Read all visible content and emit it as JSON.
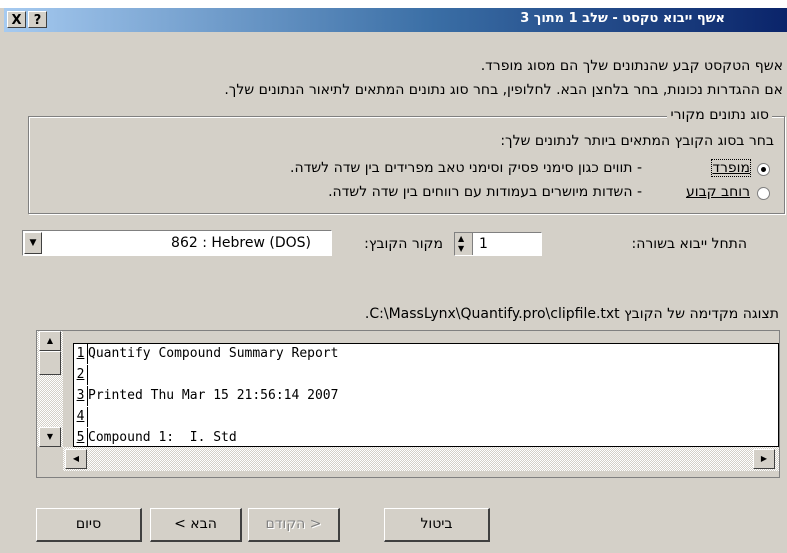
{
  "window": {
    "title": "אשף ייבוא טקסט - שלב 1 מתוך 3",
    "help_label": "?",
    "close_label": "X"
  },
  "intro": {
    "line1": "אשף הטקסט קבע שהנתונים שלך הם מסוג מופרד.",
    "line2": "אם ההגדרות נכונות, בחר בלחצן הבא. לחלופין, בחר סוג נתונים המתאים לתיאור הנתונים שלך."
  },
  "data_type_group": {
    "legend": "סוג נתונים מקורי",
    "prompt": "בחר בסוג הקובץ המתאים ביותר לנתונים שלך:",
    "options": [
      {
        "label": "מופרד",
        "description": "- תווים כגון סימני פסיק וסימני טאב מפרידים בין שדה לשדה.",
        "selected": true
      },
      {
        "label": "רוחב קבוע",
        "description": "- השדות מיושרים בעמודות עם רווחים בין שדה לשדה.",
        "selected": false
      }
    ]
  },
  "start_row": {
    "label": "התחל ייבוא בשורה:",
    "value": "1"
  },
  "file_origin": {
    "label": "מקור הקובץ:",
    "value": "862 : Hebrew (DOS)"
  },
  "preview": {
    "label": "תצוגה מקדימה של הקובץ C:\\MassLynx\\Quantify.pro\\clipfile.txt.",
    "rows": [
      {
        "num": "1",
        "text": "Quantify Compound Summary Report"
      },
      {
        "num": "2",
        "text": ""
      },
      {
        "num": "3",
        "text": "Printed Thu Mar 15 21:56:14 2007"
      },
      {
        "num": "4",
        "text": ""
      },
      {
        "num": "5",
        "text": "Compound 1:  I. Std"
      }
    ]
  },
  "buttons": {
    "cancel": "ביטול",
    "back": "< הקודם",
    "next": "הבא >",
    "finish": "סיום"
  }
}
